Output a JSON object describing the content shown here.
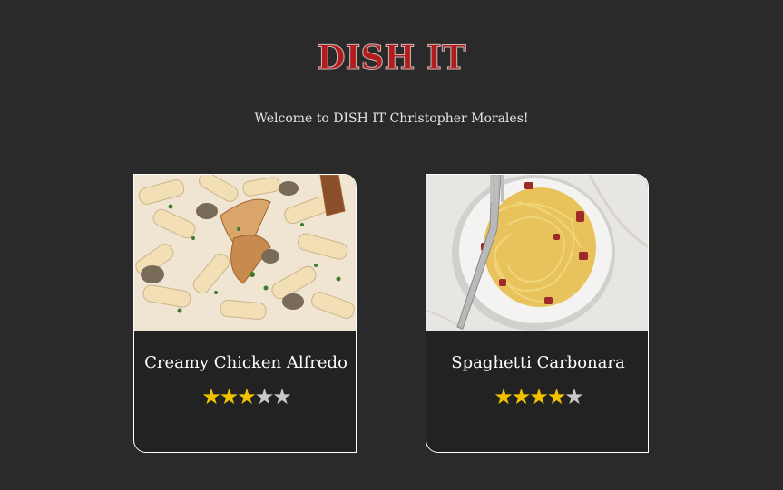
{
  "header": {
    "brand": "DISH IT",
    "welcome": "Welcome to DISH IT Christopher Morales!"
  },
  "recipes": [
    {
      "title": "Creamy Chicken Alfredo",
      "image": "pasta-penne-chicken-photo",
      "rating": 3,
      "rating_max": 5
    },
    {
      "title": "Spaghetti Carbonara",
      "image": "spaghetti-carbonara-photo",
      "rating": 4,
      "rating_max": 5
    }
  ],
  "colors": {
    "background": "#2a2a2a",
    "brand": "#b21c1c",
    "star_on": "#f2c200",
    "star_off": "#c9c9c9"
  }
}
